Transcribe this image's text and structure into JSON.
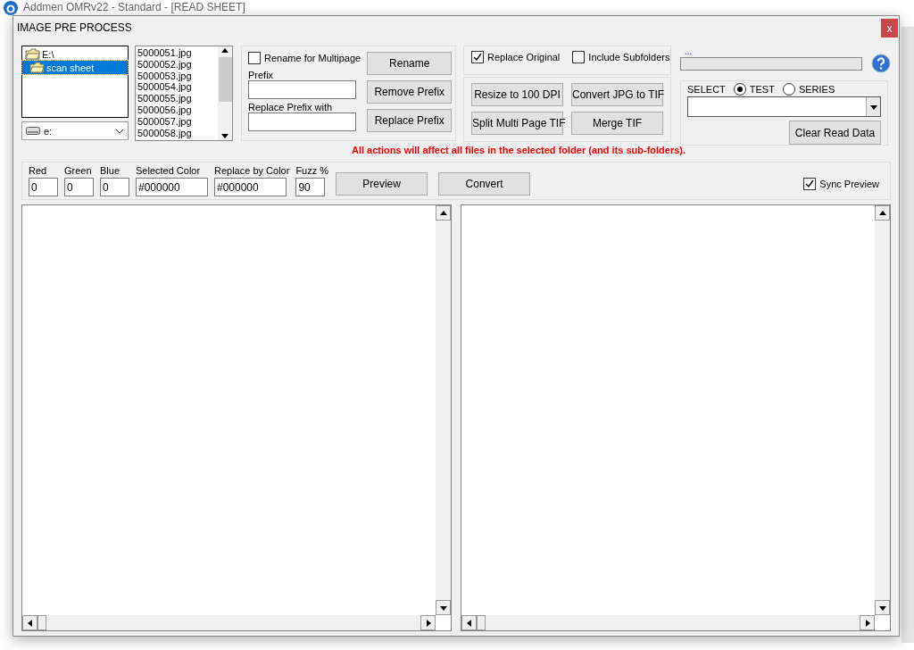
{
  "background_window": {
    "title": "Addmen OMRv22 - Standard - [READ SHEET]"
  },
  "dialog": {
    "title": "IMAGE PRE PROCESS",
    "close": "x"
  },
  "folder_tree": [
    {
      "label": "E:\\",
      "selected": false,
      "children": [
        {
          "label": "scan sheet",
          "selected": true
        }
      ]
    }
  ],
  "drive": {
    "value": "e:"
  },
  "files": [
    "5000051.jpg",
    "5000052.jpg",
    "5000053.jpg",
    "5000054.jpg",
    "5000055.jpg",
    "5000056.jpg",
    "5000057.jpg",
    "5000058.jpg"
  ],
  "rename": {
    "multipage": {
      "label": "Rename for Multipage",
      "checked": false
    },
    "prefix_label": "Prefix",
    "replace_label": "Replace Prefix with",
    "buttons": [
      "Rename",
      "Remove Prefix",
      "Replace Prefix"
    ]
  },
  "options": [
    {
      "label": "Replace Original",
      "checked": true
    },
    {
      "label": "Include Subfolders",
      "checked": false
    }
  ],
  "actions": [
    "Resize to 100 DPI",
    "Convert JPG to TIF",
    "Split Multi Page TIF",
    "Merge TIF"
  ],
  "progress": {
    "label": "...",
    "level": 0
  },
  "select": {
    "label": "SELECT",
    "radios": [
      {
        "label": "TEST",
        "selected": true
      },
      {
        "label": "SERIES",
        "selected": false
      }
    ],
    "button": "Clear Read Data"
  },
  "warning": "All actions will affect all files in the selected folder (and its sub-folders).",
  "color_fields": [
    {
      "label": "Red",
      "value": "0",
      "kind": "small"
    },
    {
      "label": "Green",
      "value": "0",
      "kind": "small"
    },
    {
      "label": "Blue",
      "value": "0",
      "kind": "small"
    },
    {
      "label": "Selected Color",
      "value": "#000000",
      "kind": "wide"
    },
    {
      "label": "Replace by Color",
      "value": "#000000",
      "kind": "wide"
    },
    {
      "label": "Fuzz %",
      "value": "90",
      "kind": "small"
    }
  ],
  "color_buttons": [
    "Preview",
    "Convert"
  ],
  "sync_preview": {
    "label": "Sync Preview",
    "checked": true
  }
}
